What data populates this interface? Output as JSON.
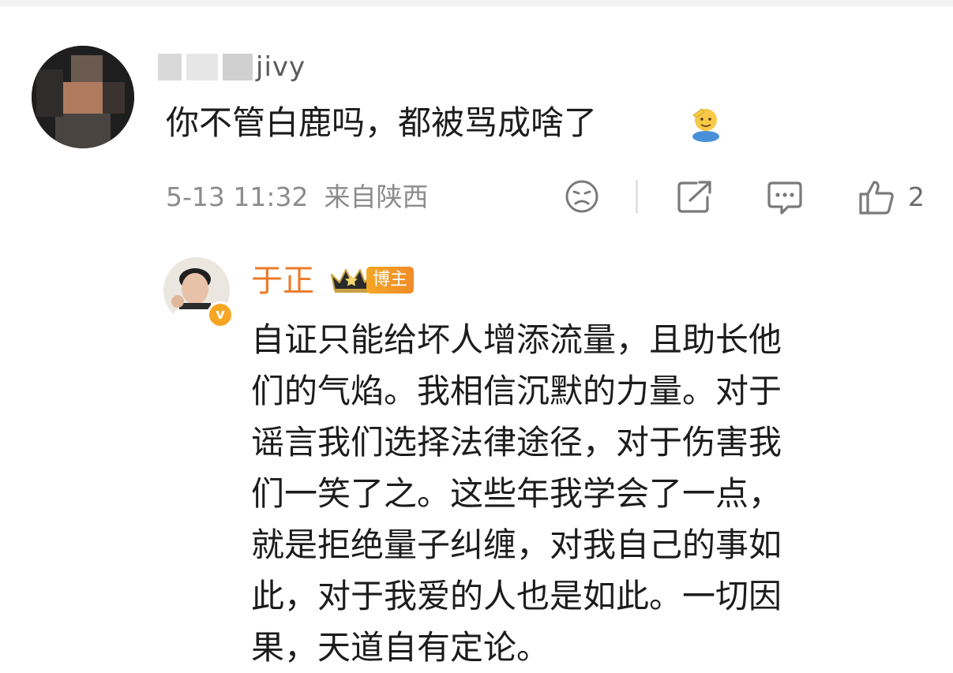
{
  "comment": {
    "username_visible": "jivy",
    "text": "你不管白鹿吗，都被骂成啥了",
    "emoji": "salute-face-emoji",
    "time": "5-13 11:32",
    "location": "来自陕西",
    "like_count": "2",
    "actions": [
      "dislike-icon",
      "share-icon",
      "comment-icon",
      "like-icon"
    ]
  },
  "reply": {
    "author": "于正",
    "badge": "博主",
    "verified_symbol": "v",
    "lines": [
      "自证只能给坏人增添流量，且助长他",
      "们的气焰。我相信沉默的力量。对于",
      "谣言我们选择法律途径，对于伤害我",
      "们一笑了之。这些年我学会了一点，",
      "就是拒绝量子纠缠，对我自己的事如",
      "此，对于我爱的人也是如此。一切因",
      "果，天道自有定论。"
    ]
  },
  "colors": {
    "author_name": "#eb7b2a",
    "badge": "#f5a623",
    "meta_gray": "#8c8c8c"
  }
}
